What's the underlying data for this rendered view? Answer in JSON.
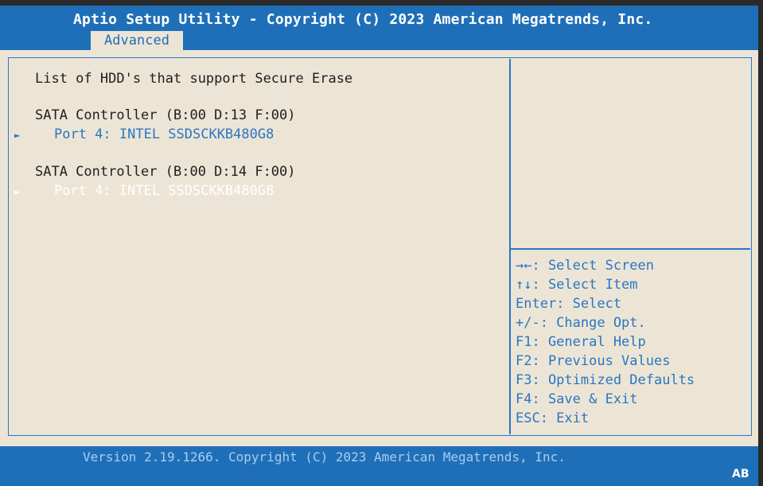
{
  "header": {
    "title": "Aptio Setup Utility - Copyright (C) 2023 American Megatrends, Inc.",
    "active_tab": "Advanced"
  },
  "main": {
    "heading": "List of HDD's that support Secure Erase",
    "controllers": [
      {
        "label": "SATA Controller (B:00 D:13 F:00)",
        "port": "Port 4:  INTEL SSDSCKKB480G8",
        "selected": false
      },
      {
        "label": "SATA Controller (B:00 D:14 F:00)",
        "port": "Port 4:  INTEL SSDSCKKB480G8",
        "selected": true
      }
    ]
  },
  "help": {
    "items": [
      "→←: Select Screen",
      "↑↓: Select Item",
      "Enter: Select",
      "+/-: Change Opt.",
      "F1: General Help",
      "F2: Previous Values",
      "F3: Optimized Defaults",
      "F4: Save & Exit",
      "ESC: Exit"
    ]
  },
  "footer": {
    "version": "Version 2.19.1266. Copyright (C) 2023 American Megatrends, Inc.",
    "badge": "AB"
  },
  "colors": {
    "background_blue": "#1f6fb8",
    "panel_beige": "#ece5d6",
    "link_blue": "#2a76c2"
  },
  "icons": {
    "submenu_arrow": "right-pointer-icon"
  }
}
